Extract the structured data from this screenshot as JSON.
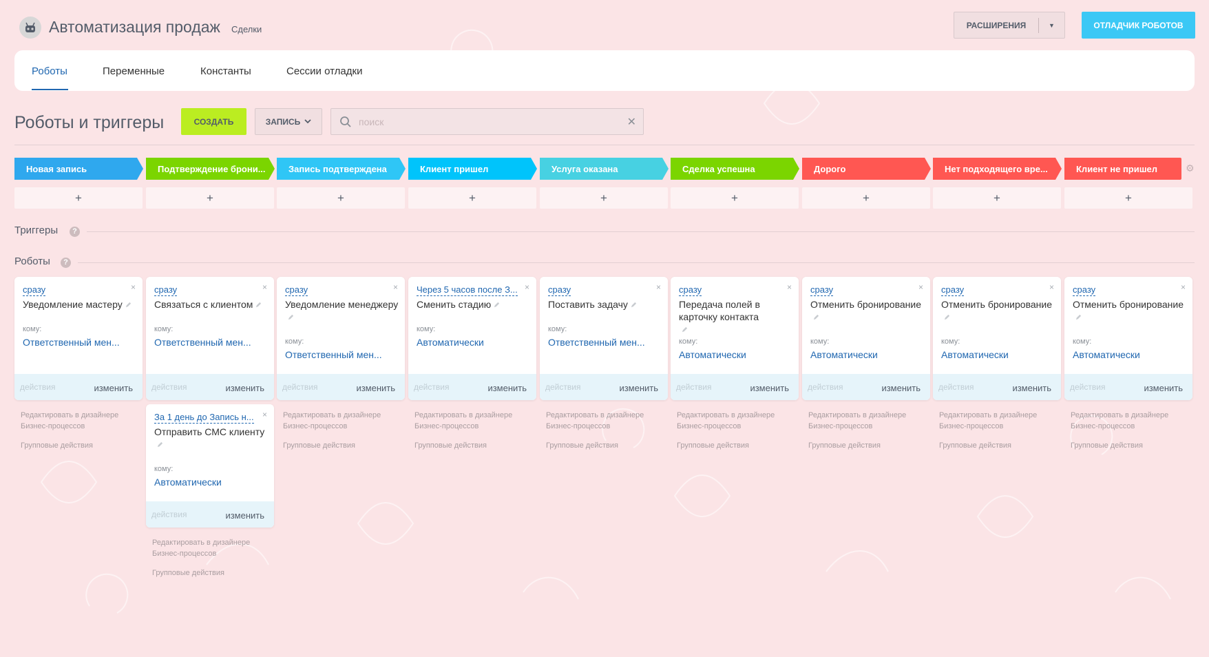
{
  "header": {
    "title": "Автоматизация продаж",
    "subtitle": "Сделки",
    "extensions_label": "РАСШИРЕНИЯ",
    "debugger_label": "ОТЛАДЧИК РОБОТОВ"
  },
  "tabs": [
    {
      "label": "Роботы",
      "active": true
    },
    {
      "label": "Переменные",
      "active": false
    },
    {
      "label": "Константы",
      "active": false
    },
    {
      "label": "Сессии отладки",
      "active": false
    }
  ],
  "toolbar": {
    "title": "Роботы и триггеры",
    "create_label": "СОЗДАТЬ",
    "record_label": "ЗАПИСЬ",
    "search_placeholder": "поиск"
  },
  "stages": [
    {
      "label": "Новая запись",
      "color": "#2fa8ee"
    },
    {
      "label": "Подтверждение брони...",
      "color": "#7bd500"
    },
    {
      "label": "Запись подтверждена",
      "color": "#2fc6f6"
    },
    {
      "label": "Клиент пришел",
      "color": "#00c4fb"
    },
    {
      "label": "Услуга оказана",
      "color": "#47d1e2"
    },
    {
      "label": "Сделка успешна",
      "color": "#7bd500"
    },
    {
      "label": "Дорого",
      "color": "#ff5752"
    },
    {
      "label": "Нет подходящего вре...",
      "color": "#ff5752"
    },
    {
      "label": "Клиент не пришел",
      "color": "#ff5752"
    }
  ],
  "add_symbol": "+",
  "sections": {
    "triggers": "Триггеры",
    "robots": "Роботы",
    "help": "?"
  },
  "card_labels": {
    "to": "кому:",
    "actions": "действия",
    "edit": "изменить",
    "close": "×"
  },
  "robots": [
    {
      "when": "сразу",
      "name": "Уведомление мастеру",
      "to": "Ответственный мен..."
    },
    {
      "when": "сразу",
      "name": "Связаться с клиентом",
      "to": "Ответственный мен..."
    },
    {
      "when": "сразу",
      "name": "Уведомление менеджеру",
      "to": "Ответственный мен..."
    },
    {
      "when": "Через 5 часов после З...",
      "name": "Сменить стадию",
      "to": "Автоматически"
    },
    {
      "when": "сразу",
      "name": "Поставить задачу",
      "to": "Ответственный мен..."
    },
    {
      "when": "сразу",
      "name": "Передача полей в карточку контакта",
      "to": "Автоматически"
    },
    {
      "when": "сразу",
      "name": "Отменить бронирование",
      "to": "Автоматически"
    },
    {
      "when": "сразу",
      "name": "Отменить бронирование",
      "to": "Автоматически"
    },
    {
      "when": "сразу",
      "name": "Отменить бронирование",
      "to": "Автоматически"
    },
    {
      "when": "За 1 день до Запись н...",
      "name": "Отправить СМС клиенту",
      "to": "Автоматически"
    }
  ],
  "column_links": {
    "designer": "Редактировать в дизайнере Бизнес-процессов",
    "group": "Групповые действия"
  }
}
